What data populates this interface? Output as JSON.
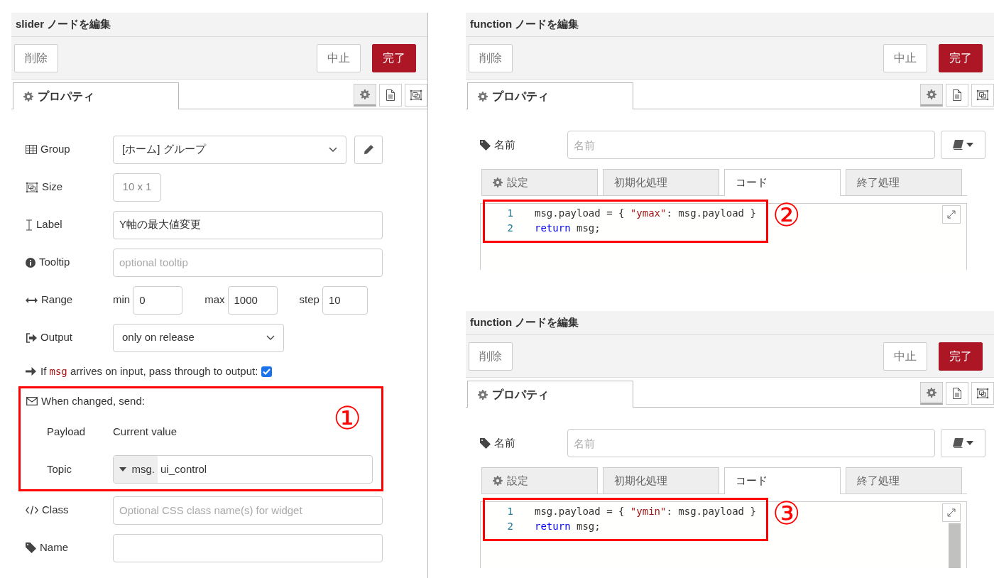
{
  "slider_editor": {
    "title": "slider ノードを編集",
    "delete_button": "削除",
    "cancel_button": "中止",
    "done_button": "完了",
    "tab": {
      "label": "プロパティ",
      "selected": true
    },
    "fields": [
      {
        "kind": "select-edit",
        "label": "Group",
        "value": "[ホーム] グループ"
      },
      {
        "kind": "size",
        "label": "Size",
        "value": "10 x 1"
      },
      {
        "kind": "input",
        "label": "Label",
        "value": "Y軸の最大値変更"
      },
      {
        "kind": "input",
        "label": "Tooltip",
        "placeholder": "optional tooltip"
      },
      {
        "kind": "range",
        "label": "Range",
        "min_label": "min",
        "min": "0",
        "max_label": "max",
        "max": "1000",
        "step_label": "step",
        "step": "10"
      },
      {
        "kind": "select",
        "label": "Output",
        "value": "only on release"
      },
      {
        "kind": "check",
        "text": "If **msg** arrives on input, pass through to output:",
        "checked": true
      },
      {
        "kind": "send",
        "label": "When changed, send:",
        "payload_label": "Payload",
        "payload_value": "Current value",
        "topic_label": "Topic",
        "topic_type": "msg.",
        "topic_value": "ui_control",
        "annotation": "①"
      },
      {
        "kind": "input",
        "label": "Class",
        "placeholder": "Optional CSS class name(s) for widget"
      },
      {
        "kind": "input",
        "label": "Name"
      }
    ]
  },
  "function_editors": [
    {
      "title": "function ノードを編集",
      "delete_button": "削除",
      "cancel_button": "中止",
      "done_button": "完了",
      "tab": {
        "label": "プロパティ",
        "selected": true
      },
      "name_label": "名前",
      "name_placeholder": "名前",
      "subtabs": [
        {
          "label": "設定",
          "selected": false
        },
        {
          "label": "初期化処理",
          "selected": false
        },
        {
          "label": "コード",
          "selected": true
        },
        {
          "label": "終了処理",
          "selected": false
        }
      ],
      "code_lines": [
        {
          "number": "1",
          "tokens": [
            {
              "kind": "plain",
              "text": "msg.payload = { "
            },
            {
              "kind": "string",
              "text": "\"ymax\""
            },
            {
              "kind": "plain",
              "text": ": msg.payload }"
            }
          ]
        },
        {
          "number": "2",
          "tokens": [
            {
              "kind": "keyword",
              "text": "return"
            },
            {
              "kind": "plain",
              "text": " msg;"
            }
          ]
        }
      ],
      "annotation": "②"
    },
    {
      "title": "function ノードを編集",
      "delete_button": "削除",
      "cancel_button": "中止",
      "done_button": "完了",
      "tab": {
        "label": "プロパティ",
        "selected": true
      },
      "name_label": "名前",
      "name_placeholder": "名前",
      "subtabs": [
        {
          "label": "設定",
          "selected": false
        },
        {
          "label": "初期化処理",
          "selected": false
        },
        {
          "label": "コード",
          "selected": true
        },
        {
          "label": "終了処理",
          "selected": false
        }
      ],
      "code_lines": [
        {
          "number": "1",
          "tokens": [
            {
              "kind": "plain",
              "text": "msg.payload = { "
            },
            {
              "kind": "string",
              "text": "\"ymin\""
            },
            {
              "kind": "plain",
              "text": ": msg.payload }"
            }
          ]
        },
        {
          "number": "2",
          "tokens": [
            {
              "kind": "keyword",
              "text": "return"
            },
            {
              "kind": "plain",
              "text": " msg;"
            }
          ]
        }
      ],
      "annotation": "③"
    }
  ]
}
